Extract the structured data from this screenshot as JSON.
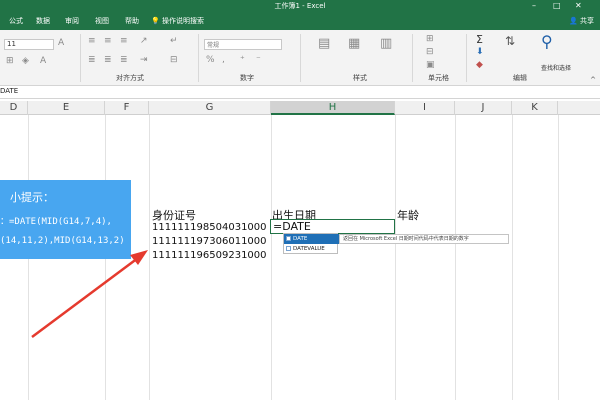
{
  "window": {
    "title": "工作簿1 - Excel"
  },
  "tabs": [
    "公式",
    "数据",
    "审阅",
    "视图",
    "帮助"
  ],
  "tell_me": "操作说明搜索",
  "share": "共享",
  "ribbon": {
    "font_size": "11",
    "number_format": "常规",
    "groups": [
      "对齐方式",
      "数字",
      "样式",
      "单元格",
      "编辑"
    ],
    "find_select": "查找和选择"
  },
  "formula_bar": {
    "name_box": "DATE"
  },
  "columns": [
    "D",
    "E",
    "F",
    "G",
    "H",
    "I",
    "J",
    "K"
  ],
  "active_column": "H",
  "cells": {
    "header_id": "身份证号",
    "header_birth": "出生日期",
    "header_age": "年龄",
    "ids": [
      "111111198504031000",
      "111111197306011000",
      "111111196509231000"
    ],
    "editing_value": "=DATE"
  },
  "autocomplete": {
    "items": [
      "DATE",
      "DATEVALUE"
    ],
    "selected": "DATE",
    "tooltip": "返回在 Microsoft Excel 日期时间代码中代表日期的数字"
  },
  "tip": {
    "title": "小提示：",
    "line1": "：=DATE(MID(G14,7,4),",
    "line2": "(14,11,2),MID(G14,13,2)"
  },
  "colors": {
    "excel_green": "#217346",
    "tip_blue": "#48a6f0",
    "arrow_red": "#e53a2e"
  }
}
